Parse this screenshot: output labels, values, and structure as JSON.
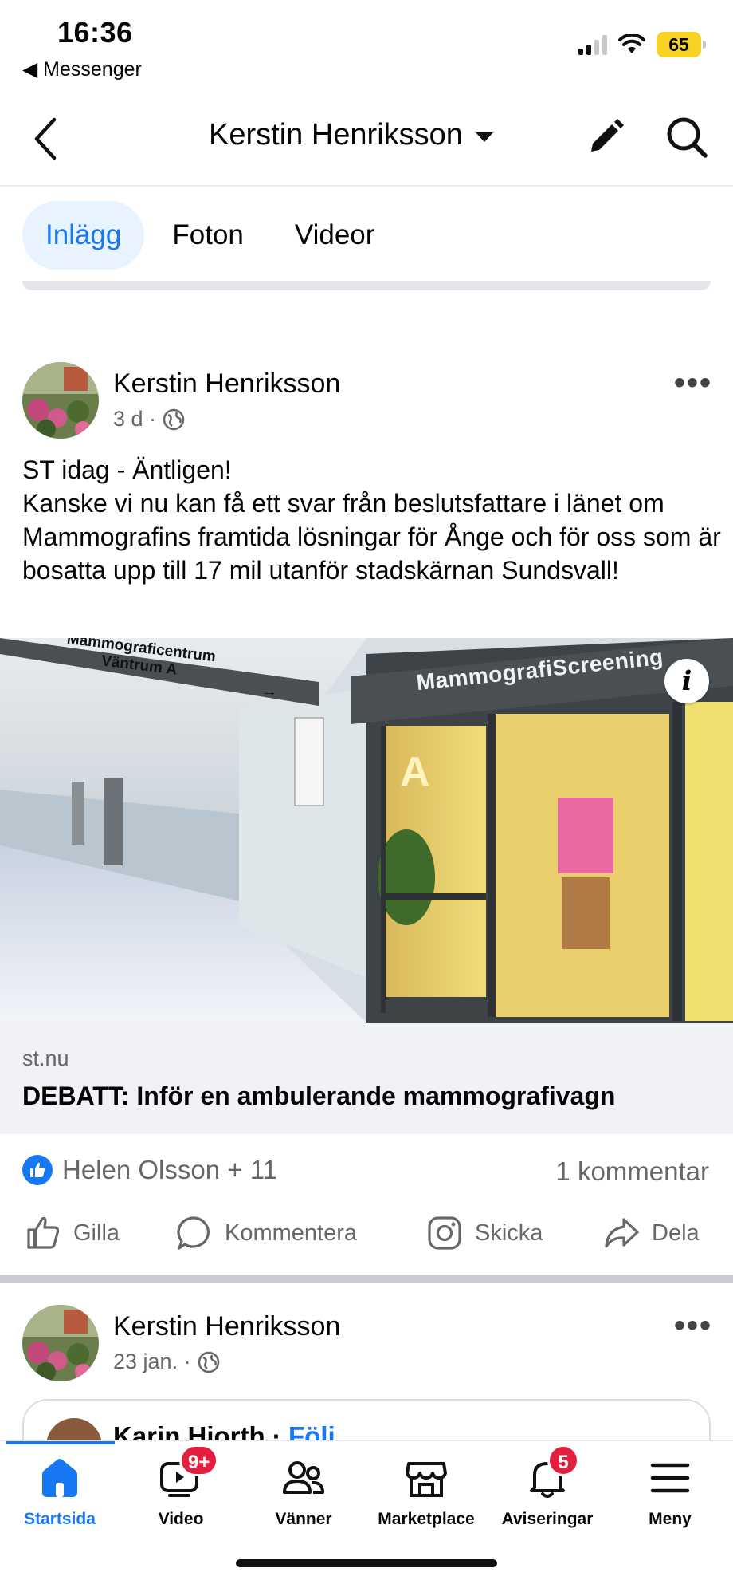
{
  "status_bar": {
    "time": "16:36",
    "back_app": "◀ Messenger",
    "battery": "65",
    "battery_color": "#f5d224"
  },
  "header": {
    "title": "Kerstin Henriksson",
    "icons": [
      "back-arrow-icon",
      "dropdown-caret-icon",
      "edit-pencil-icon",
      "search-icon"
    ]
  },
  "tabs": [
    {
      "label": "Inlägg",
      "active": true
    },
    {
      "label": "Foton",
      "active": false
    },
    {
      "label": "Videor",
      "active": false
    }
  ],
  "post1": {
    "author": "Kerstin Henriksson",
    "time": "3 d ·",
    "text": "ST idag - Äntligen!\nKanske vi nu kan få ett svar från beslutsfattare i länet om Mammografins framtida lösningar för Ånge och för oss som är bosatta upp till 17 mil utanför stadskärnan Sundsvall!",
    "image_signs": {
      "hall_sign_line1": "Mammograficentrum",
      "hall_sign_line2": "Väntrum A",
      "entrance_sign": "MammografiScreening",
      "door_letter": "A"
    },
    "link": {
      "domain": "st.nu",
      "title": "DEBATT: Inför en ambulerande mammografivagn"
    },
    "reactions": "Helen Olsson + 11",
    "comments": "1 kommentar",
    "actions": {
      "like": "Gilla",
      "comment": "Kommentera",
      "send": "Skicka",
      "share": "Dela"
    }
  },
  "post2": {
    "author": "Kerstin Henriksson",
    "time": "23 jan. ·",
    "shared_name": "Karin Hjorth · ",
    "shared_follow": "Följ"
  },
  "bottom_nav": [
    {
      "label": "Startsida",
      "active": true
    },
    {
      "label": "Video",
      "badge": "9+"
    },
    {
      "label": "Vänner"
    },
    {
      "label": "Marketplace"
    },
    {
      "label": "Aviseringar",
      "badge": "5"
    },
    {
      "label": "Meny"
    }
  ],
  "colors": {
    "accent": "#1877f2",
    "badge": "#e41e3f",
    "secondary_text": "#65676b"
  }
}
